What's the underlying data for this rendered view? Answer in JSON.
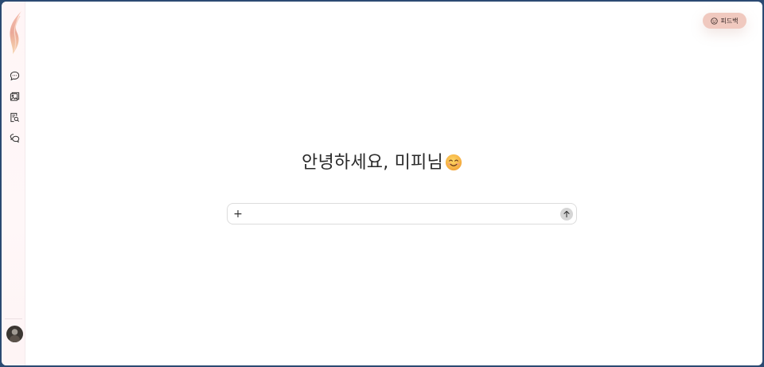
{
  "feedback": {
    "label": "피드백",
    "icon": "smile-icon",
    "bg": "#f0c9bf"
  },
  "sidebar": {
    "items": [
      {
        "name": "chat",
        "icon": "chat-bubble-icon"
      },
      {
        "name": "image",
        "icon": "image-gallery-icon"
      },
      {
        "name": "document-search",
        "icon": "document-search-icon"
      },
      {
        "name": "conversations",
        "icon": "chat-history-icon"
      }
    ]
  },
  "main": {
    "greeting": "안녕하세요, 미피님",
    "greeting_emoji": "smiling-face-icon"
  },
  "composer": {
    "plus_label": "+",
    "placeholder": "",
    "value": "",
    "send_icon": "arrow-up-icon"
  },
  "colors": {
    "frame_border": "#2b4a72",
    "sidebar_bg": "#fff5f6",
    "accent": "#f0c9bf"
  }
}
